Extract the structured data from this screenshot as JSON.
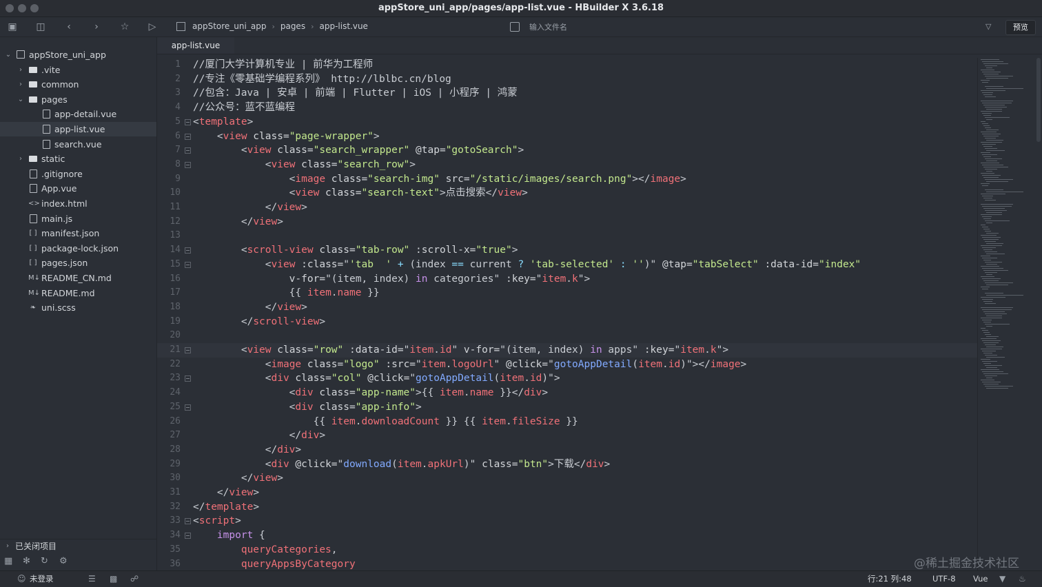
{
  "window": {
    "title": "appStore_uni_app/pages/app-list.vue - HBuilder X 3.6.18"
  },
  "toolbar": {
    "breadcrumb": [
      "appStore_uni_app",
      "pages",
      "app-list.vue"
    ],
    "file_search_placeholder": "输入文件名",
    "preview_label": "预览"
  },
  "sidebar": {
    "items": [
      {
        "label": "appStore_uni_app",
        "kind": "project",
        "depth": 0,
        "expanded": true
      },
      {
        "label": ".vite",
        "kind": "folder",
        "depth": 1,
        "expanded": false
      },
      {
        "label": "common",
        "kind": "folder",
        "depth": 1,
        "expanded": false
      },
      {
        "label": "pages",
        "kind": "folder",
        "depth": 1,
        "expanded": true
      },
      {
        "label": "app-detail.vue",
        "kind": "file",
        "depth": 2
      },
      {
        "label": "app-list.vue",
        "kind": "file",
        "depth": 2,
        "selected": true
      },
      {
        "label": "search.vue",
        "kind": "file",
        "depth": 2
      },
      {
        "label": "static",
        "kind": "folder",
        "depth": 1,
        "expanded": false
      },
      {
        "label": ".gitignore",
        "kind": "file",
        "depth": 1
      },
      {
        "label": "App.vue",
        "kind": "file",
        "depth": 1
      },
      {
        "label": "index.html",
        "kind": "html",
        "depth": 1
      },
      {
        "label": "main.js",
        "kind": "file",
        "depth": 1
      },
      {
        "label": "manifest.json",
        "kind": "json",
        "depth": 1
      },
      {
        "label": "package-lock.json",
        "kind": "json",
        "depth": 1
      },
      {
        "label": "pages.json",
        "kind": "json",
        "depth": 1
      },
      {
        "label": "README_CN.md",
        "kind": "md",
        "depth": 1
      },
      {
        "label": "README.md",
        "kind": "md",
        "depth": 1
      },
      {
        "label": "uni.scss",
        "kind": "style",
        "depth": 1
      }
    ],
    "closed_projects_label": "已关闭项目"
  },
  "editor": {
    "tab_label": "app-list.vue",
    "current_line": 21,
    "lines": [
      {
        "n": "1",
        "fold": false,
        "segs": [
          [
            "c",
            "//厦门大学计算机专业 | 前华为工程师"
          ]
        ]
      },
      {
        "n": "2",
        "fold": false,
        "segs": [
          [
            "c",
            "//专注《零基础学编程系列》 http://lblbc.cn/blog"
          ]
        ]
      },
      {
        "n": "3",
        "fold": false,
        "segs": [
          [
            "c",
            "//包含：Java | 安卓 | 前端 | Flutter | iOS | 小程序 | 鸿蒙"
          ]
        ]
      },
      {
        "n": "4",
        "fold": false,
        "segs": [
          [
            "c",
            "//公众号：蓝不蓝编程"
          ]
        ]
      },
      {
        "n": "5",
        "fold": true,
        "segs": [
          [
            "p",
            "<"
          ],
          [
            "t",
            "template"
          ],
          [
            "p",
            ">"
          ]
        ]
      },
      {
        "n": "6",
        "fold": true,
        "segs": [
          [
            "p",
            "    <"
          ],
          [
            "t",
            "view"
          ],
          [
            "a",
            " class="
          ],
          [
            "s",
            "\"page-wrapper\""
          ],
          [
            "p",
            ">"
          ]
        ]
      },
      {
        "n": "7",
        "fold": true,
        "segs": [
          [
            "p",
            "        <"
          ],
          [
            "t",
            "view"
          ],
          [
            "a",
            " class="
          ],
          [
            "s",
            "\"search_wrapper\""
          ],
          [
            "a",
            " @tap="
          ],
          [
            "s",
            "\"gotoSearch\""
          ],
          [
            "p",
            ">"
          ]
        ]
      },
      {
        "n": "8",
        "fold": true,
        "segs": [
          [
            "p",
            "            <"
          ],
          [
            "t",
            "view"
          ],
          [
            "a",
            " class="
          ],
          [
            "s",
            "\"search_row\""
          ],
          [
            "p",
            ">"
          ]
        ]
      },
      {
        "n": "9",
        "fold": false,
        "segs": [
          [
            "p",
            "                <"
          ],
          [
            "t",
            "image"
          ],
          [
            "a",
            " class="
          ],
          [
            "s",
            "\"search-img\""
          ],
          [
            "a",
            " src="
          ],
          [
            "s",
            "\"/static/images/search.png\""
          ],
          [
            "p",
            "></"
          ],
          [
            "t",
            "image"
          ],
          [
            "p",
            ">"
          ]
        ]
      },
      {
        "n": "10",
        "fold": false,
        "segs": [
          [
            "p",
            "                <"
          ],
          [
            "t",
            "view"
          ],
          [
            "a",
            " class="
          ],
          [
            "s",
            "\"search-text\""
          ],
          [
            "p",
            ">点击搜索</"
          ],
          [
            "t",
            "view"
          ],
          [
            "p",
            ">"
          ]
        ]
      },
      {
        "n": "11",
        "fold": false,
        "segs": [
          [
            "p",
            "            </"
          ],
          [
            "t",
            "view"
          ],
          [
            "p",
            ">"
          ]
        ]
      },
      {
        "n": "12",
        "fold": false,
        "segs": [
          [
            "p",
            "        </"
          ],
          [
            "t",
            "view"
          ],
          [
            "p",
            ">"
          ]
        ]
      },
      {
        "n": "13",
        "fold": false,
        "segs": [
          [
            "p",
            ""
          ]
        ]
      },
      {
        "n": "14",
        "fold": true,
        "segs": [
          [
            "p",
            "        <"
          ],
          [
            "t",
            "scroll-view"
          ],
          [
            "a",
            " class="
          ],
          [
            "s",
            "\"tab-row\""
          ],
          [
            "a",
            " :scroll-x="
          ],
          [
            "s",
            "\"true\""
          ],
          [
            "p",
            ">"
          ]
        ]
      },
      {
        "n": "15",
        "fold": true,
        "segs": [
          [
            "p",
            "            <"
          ],
          [
            "t",
            "view"
          ],
          [
            "a",
            " :class="
          ],
          [
            "p",
            "\""
          ],
          [
            "s",
            "'tab  '"
          ],
          [
            "o",
            " + "
          ],
          [
            "p",
            "(index "
          ],
          [
            "o",
            "=="
          ],
          [
            "p",
            " current "
          ],
          [
            "o",
            "?"
          ],
          [
            "s",
            " 'tab-selected'"
          ],
          [
            "o",
            " : "
          ],
          [
            "s",
            "''"
          ],
          [
            "p",
            ")\""
          ],
          [
            "a",
            " @tap="
          ],
          [
            "s",
            "\"tabSelect\""
          ],
          [
            "a",
            " :data-id="
          ],
          [
            "s",
            "\"index\""
          ]
        ]
      },
      {
        "n": "16",
        "fold": false,
        "segs": [
          [
            "a",
            "                v-for="
          ],
          [
            "p",
            "\"(item, index) "
          ],
          [
            "k",
            "in"
          ],
          [
            "p",
            " categories\""
          ],
          [
            "a",
            " :key="
          ],
          [
            "p",
            "\""
          ],
          [
            "v",
            "item"
          ],
          [
            "p",
            "."
          ],
          [
            "v",
            "k"
          ],
          [
            "p",
            "\">"
          ]
        ]
      },
      {
        "n": "17",
        "fold": false,
        "segs": [
          [
            "p",
            "                {{ "
          ],
          [
            "v",
            "item"
          ],
          [
            "p",
            "."
          ],
          [
            "v",
            "name"
          ],
          [
            "p",
            " }}"
          ]
        ]
      },
      {
        "n": "18",
        "fold": false,
        "segs": [
          [
            "p",
            "            </"
          ],
          [
            "t",
            "view"
          ],
          [
            "p",
            ">"
          ]
        ]
      },
      {
        "n": "19",
        "fold": false,
        "segs": [
          [
            "p",
            "        </"
          ],
          [
            "t",
            "scroll-view"
          ],
          [
            "p",
            ">"
          ]
        ]
      },
      {
        "n": "20",
        "fold": false,
        "segs": [
          [
            "p",
            ""
          ]
        ]
      },
      {
        "n": "21",
        "fold": true,
        "segs": [
          [
            "p",
            "        <"
          ],
          [
            "t",
            "view"
          ],
          [
            "a",
            " class="
          ],
          [
            "s",
            "\"row\""
          ],
          [
            "a",
            " :data-id="
          ],
          [
            "p",
            "\""
          ],
          [
            "v",
            "item"
          ],
          [
            "p",
            "."
          ],
          [
            "v",
            "id"
          ],
          [
            "p",
            "\""
          ],
          [
            "a",
            " v-for="
          ],
          [
            "p",
            "\"(item, index) "
          ],
          [
            "k",
            "in"
          ],
          [
            "p",
            " apps\""
          ],
          [
            "a",
            " :key="
          ],
          [
            "p",
            "\""
          ],
          [
            "v",
            "item"
          ],
          [
            "p",
            "."
          ],
          [
            "v",
            "k"
          ],
          [
            "p",
            "\">"
          ]
        ]
      },
      {
        "n": "22",
        "fold": false,
        "segs": [
          [
            "p",
            "            <"
          ],
          [
            "t",
            "image"
          ],
          [
            "a",
            " class="
          ],
          [
            "s",
            "\"logo\""
          ],
          [
            "a",
            " :src="
          ],
          [
            "p",
            "\""
          ],
          [
            "v",
            "item"
          ],
          [
            "p",
            "."
          ],
          [
            "v",
            "logoUrl"
          ],
          [
            "p",
            "\""
          ],
          [
            "a",
            " @click="
          ],
          [
            "p",
            "\""
          ],
          [
            "f",
            "gotoAppDetail"
          ],
          [
            "p",
            "("
          ],
          [
            "v",
            "item"
          ],
          [
            "p",
            "."
          ],
          [
            "v",
            "id"
          ],
          [
            "p",
            ")\"></"
          ],
          [
            "t",
            "image"
          ],
          [
            "p",
            ">"
          ]
        ]
      },
      {
        "n": "23",
        "fold": true,
        "segs": [
          [
            "p",
            "            <"
          ],
          [
            "t",
            "div"
          ],
          [
            "a",
            " class="
          ],
          [
            "s",
            "\"col\""
          ],
          [
            "a",
            " @click="
          ],
          [
            "p",
            "\""
          ],
          [
            "f",
            "gotoAppDetail"
          ],
          [
            "p",
            "("
          ],
          [
            "v",
            "item"
          ],
          [
            "p",
            "."
          ],
          [
            "v",
            "id"
          ],
          [
            "p",
            ")\">"
          ]
        ]
      },
      {
        "n": "24",
        "fold": false,
        "segs": [
          [
            "p",
            "                <"
          ],
          [
            "t",
            "div"
          ],
          [
            "a",
            " class="
          ],
          [
            "s",
            "\"app-name\""
          ],
          [
            "p",
            ">{{ "
          ],
          [
            "v",
            "item"
          ],
          [
            "p",
            "."
          ],
          [
            "v",
            "name"
          ],
          [
            "p",
            " }}</"
          ],
          [
            "t",
            "div"
          ],
          [
            "p",
            ">"
          ]
        ]
      },
      {
        "n": "25",
        "fold": true,
        "segs": [
          [
            "p",
            "                <"
          ],
          [
            "t",
            "div"
          ],
          [
            "a",
            " class="
          ],
          [
            "s",
            "\"app-info\""
          ],
          [
            "p",
            ">"
          ]
        ]
      },
      {
        "n": "26",
        "fold": false,
        "segs": [
          [
            "p",
            "                    {{ "
          ],
          [
            "v",
            "item"
          ],
          [
            "p",
            "."
          ],
          [
            "v",
            "downloadCount"
          ],
          [
            "p",
            " }} {{ "
          ],
          [
            "v",
            "item"
          ],
          [
            "p",
            "."
          ],
          [
            "v",
            "fileSize"
          ],
          [
            "p",
            " }}"
          ]
        ]
      },
      {
        "n": "27",
        "fold": false,
        "segs": [
          [
            "p",
            "                </"
          ],
          [
            "t",
            "div"
          ],
          [
            "p",
            ">"
          ]
        ]
      },
      {
        "n": "28",
        "fold": false,
        "segs": [
          [
            "p",
            "            </"
          ],
          [
            "t",
            "div"
          ],
          [
            "p",
            ">"
          ]
        ]
      },
      {
        "n": "29",
        "fold": false,
        "segs": [
          [
            "p",
            "            <"
          ],
          [
            "t",
            "div"
          ],
          [
            "a",
            " @click="
          ],
          [
            "p",
            "\""
          ],
          [
            "f",
            "download"
          ],
          [
            "p",
            "("
          ],
          [
            "v",
            "item"
          ],
          [
            "p",
            "."
          ],
          [
            "v",
            "apkUrl"
          ],
          [
            "p",
            ")\""
          ],
          [
            "a",
            " class="
          ],
          [
            "s",
            "\"btn\""
          ],
          [
            "p",
            ">下载</"
          ],
          [
            "t",
            "div"
          ],
          [
            "p",
            ">"
          ]
        ]
      },
      {
        "n": "30",
        "fold": false,
        "segs": [
          [
            "p",
            "        </"
          ],
          [
            "t",
            "view"
          ],
          [
            "p",
            ">"
          ]
        ]
      },
      {
        "n": "31",
        "fold": false,
        "segs": [
          [
            "p",
            "    </"
          ],
          [
            "t",
            "view"
          ],
          [
            "p",
            ">"
          ]
        ]
      },
      {
        "n": "32",
        "fold": false,
        "segs": [
          [
            "p",
            "</"
          ],
          [
            "t",
            "template"
          ],
          [
            "p",
            ">"
          ]
        ]
      },
      {
        "n": "33",
        "fold": true,
        "segs": [
          [
            "p",
            "<"
          ],
          [
            "t",
            "script"
          ],
          [
            "p",
            ">"
          ]
        ]
      },
      {
        "n": "34",
        "fold": true,
        "segs": [
          [
            "k",
            "    import"
          ],
          [
            "p",
            " {"
          ]
        ]
      },
      {
        "n": "35",
        "fold": false,
        "segs": [
          [
            "v",
            "        queryCategories"
          ],
          [
            "p",
            ","
          ]
        ]
      },
      {
        "n": "36",
        "fold": false,
        "segs": [
          [
            "v",
            "        queryAppsByCategory"
          ]
        ]
      }
    ]
  },
  "statusbar": {
    "user": "未登录",
    "position": "行:21  列:48",
    "encoding": "UTF-8",
    "language": "Vue"
  },
  "watermark": "@稀土掘金技术社区",
  "colors": {
    "background": "#2b2f36",
    "tag": "#f07178",
    "string": "#c3e88d",
    "function": "#82aaff",
    "keyword": "#c792ea"
  }
}
